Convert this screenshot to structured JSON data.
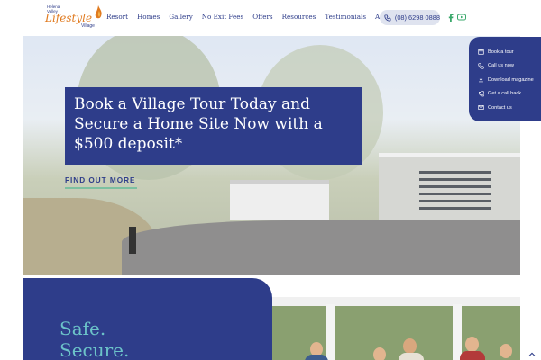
{
  "logo": {
    "line1": "Helena",
    "line2": "Valley",
    "main": "Lifestyle",
    "sub": "Village"
  },
  "nav": [
    "Resort",
    "Homes",
    "Gallery",
    "No Exit Fees",
    "Offers",
    "Resources",
    "Testimonials",
    "About"
  ],
  "phone": "(08) 6298 0888",
  "social": {
    "facebook_icon": "facebook-icon",
    "youtube_icon": "youtube-icon"
  },
  "hero": {
    "title_lines": [
      "Book a Village Tour Today and",
      "Secure a Home Site Now with a",
      "$500 deposit*"
    ],
    "cta": "FIND OUT MORE"
  },
  "side_menu": [
    {
      "label": "Book a tour",
      "icon": "calendar-icon"
    },
    {
      "label": "Call us now",
      "icon": "phone-icon"
    },
    {
      "label": "Download magazine",
      "icon": "download-icon"
    },
    {
      "label": "Get a call back",
      "icon": "callback-icon"
    },
    {
      "label": "Contact us",
      "icon": "mail-icon"
    }
  ],
  "bottom": {
    "lines": [
      "Safe.",
      "Secure."
    ]
  },
  "colors": {
    "brand_navy": "#2e3d8a",
    "accent_teal": "#6cc3c9",
    "accent_orange": "#e07a1f",
    "cta_underline": "#7cc0a0"
  }
}
